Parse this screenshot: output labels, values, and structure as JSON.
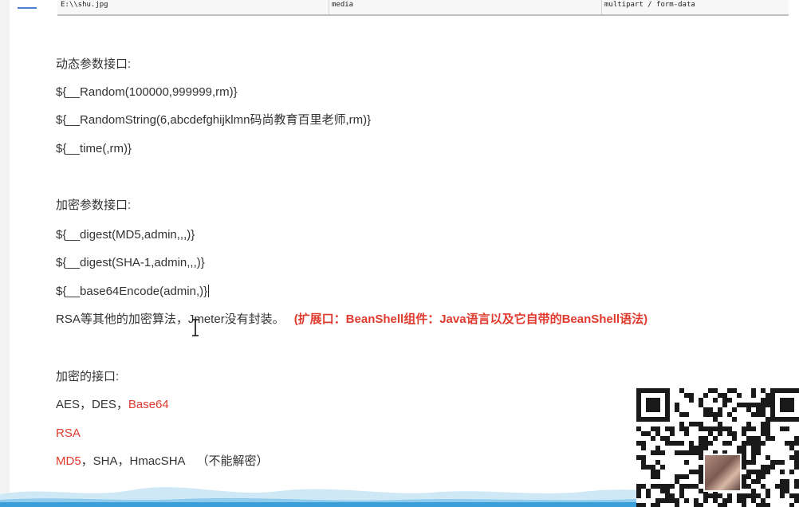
{
  "table_row": {
    "path": "E:\\\\shu.jpg",
    "name": "media",
    "type": "multipart / form-data"
  },
  "sections": {
    "dynamic": {
      "heading": "动态参数接口:",
      "lines": [
        "${__Random(100000,999999,rm)}",
        "${__RandomString(6,abcdefghijklmn码尚教育百里老师,rm)}",
        "${__time(,rm)}"
      ]
    },
    "encrypt": {
      "heading": "加密参数接口:",
      "lines": [
        "${__digest(MD5,admin,,,)}",
        "${__digest(SHA-1,admin,,,)}",
        "${__base64Encode(admin,)}"
      ],
      "note_plain": "RSA等其他的加密算法，Jmeter没有封装。",
      "note_red": "(扩展口：BeanShell组件：Java语言以及它自带的BeanShell语法)"
    },
    "crypto": {
      "heading": "加密的接口:",
      "line1_plain": "AES，DES，",
      "line1_red": "Base64",
      "line2_red": "RSA",
      "line3_red": "MD5",
      "line3_plain": "，SHA，HmacSHA",
      "line3_note": "（不能解密）"
    }
  },
  "colors": {
    "text": "#333333",
    "accent_red": "#e03a2e",
    "wave_blue": "#3a9fd8",
    "qr_dark": "#1a1a1a"
  },
  "icons": {
    "cursor": "text-ibeam-icon",
    "qr": "qr-code-icon"
  }
}
